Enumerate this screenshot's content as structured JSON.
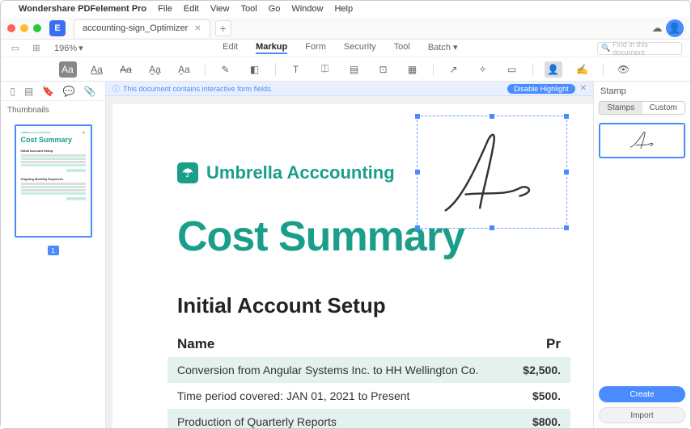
{
  "menubar": {
    "app": "Wondershare PDFelement Pro",
    "items": [
      "File",
      "Edit",
      "View",
      "Tool",
      "Go",
      "Window",
      "Help"
    ]
  },
  "titlebar": {
    "tab": "accounting-sign_Optimizer",
    "logo": "E"
  },
  "toolbar1": {
    "zoom": "196%",
    "tabs": {
      "edit": "Edit",
      "markup": "Markup",
      "form": "Form",
      "security": "Security",
      "tool": "Tool",
      "batch": "Batch"
    },
    "search_placeholder": "Find in this document"
  },
  "banner": {
    "text": "This document contains interactive form fields.",
    "button": "Disable Highlight"
  },
  "left": {
    "label": "Thumbnails",
    "thumb_brand": "UMBRELLA ACCOUNTING",
    "thumb_title": "Cost Summary",
    "thumb_s1": "Initial Account Setup",
    "thumb_s2": "Ongoing Monthly Expenses",
    "page": "1"
  },
  "doc": {
    "brand": "Umbrella Acccounting",
    "title": "Cost Summary",
    "section": "Initial Account Setup",
    "col1": "Name",
    "col2": "Pr",
    "rows": [
      {
        "name": "Conversion from Angular Systems Inc. to HH Wellington Co.",
        "price": "$2,500."
      },
      {
        "name": "Time period covered: JAN 01, 2021 to Present",
        "price": "$500."
      },
      {
        "name": "Production of Quarterly Reports",
        "price": "$800."
      }
    ]
  },
  "right": {
    "title": "Stamp",
    "tab1": "Stamps",
    "tab2": "Custom",
    "create": "Create",
    "import": "Import"
  }
}
